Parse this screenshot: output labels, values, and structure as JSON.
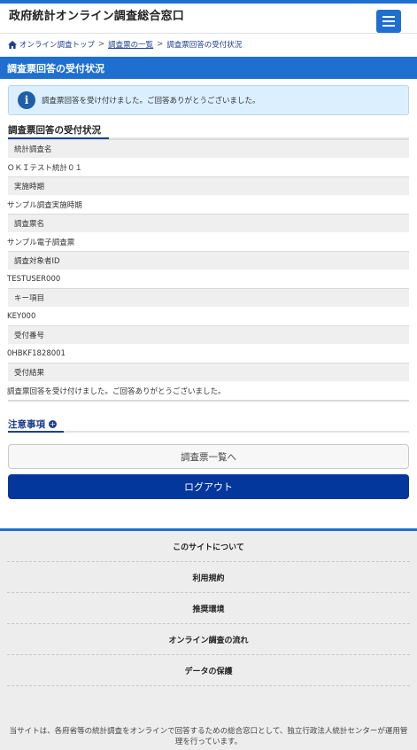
{
  "header": {
    "site_title": "政府統計オンライン調査総合窓口",
    "menu_icon": "hamburger-menu-icon"
  },
  "breadcrumb": {
    "home_icon": "home-icon",
    "home_label": "オンライン調査トップ",
    "separator": ">",
    "list_label": "調査票の一覧",
    "current_label": "調査票回答の受付状況"
  },
  "page": {
    "heading": "調査票回答の受付状況"
  },
  "info": {
    "icon": "info-icon",
    "message": "調査票回答を受け付けました。ご回答ありがとうございました。"
  },
  "section": {
    "title": "調査票回答の受付状況"
  },
  "details": [
    {
      "label": "統計調査名",
      "value": "ＯＫＩテスト統計０１"
    },
    {
      "label": "実施時期",
      "value": "サンプル調査実施時期"
    },
    {
      "label": "調査票名",
      "value": "サンプル電子調査票"
    },
    {
      "label": "調査対象者ID",
      "value": "TESTUSER000"
    },
    {
      "label": "キー項目",
      "value": "KEY000"
    },
    {
      "label": "受付番号",
      "value": "0HBKF1828001"
    },
    {
      "label": "受付結果",
      "value": "調査票回答を受け付けました。ご回答ありがとうございました。"
    }
  ],
  "notes": {
    "title": "注意事項",
    "expand_icon": "plus-circle-icon",
    "expand_symbol": "+"
  },
  "buttons": {
    "list_label": "調査票一覧へ",
    "logout_label": "ログアウト"
  },
  "footer": {
    "links": [
      "このサイトについて",
      "利用規約",
      "推奨環境",
      "オンライン調査の流れ",
      "データの保護"
    ],
    "note": "当サイトは、各府省等の統計調査をオンラインで回答するための総合窓口として、独立行政法人統計センターが運用管理を行っています。"
  },
  "colors": {
    "primary": "#1f6fd1",
    "dark_navy": "#03379c",
    "info_bg": "#dcefff"
  }
}
